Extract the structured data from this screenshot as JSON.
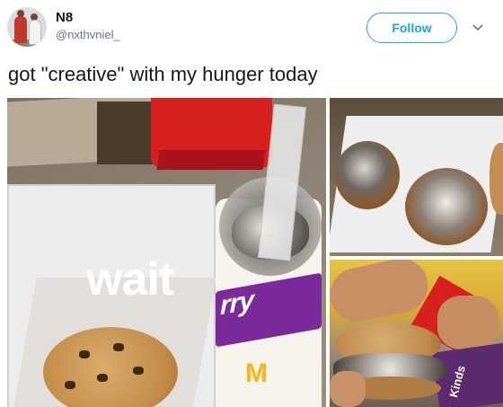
{
  "header": {
    "display_name": "N8",
    "handle": "@nxthvniel_",
    "follow_label": "Follow",
    "menu_icon": "chevron-down-icon"
  },
  "tweet": {
    "text": "got \"creative\" with my hunger today"
  },
  "media": {
    "overlay_text": "wait",
    "cup_text": "rry",
    "cup_logo": "M",
    "box_text": "Kinds"
  },
  "colors": {
    "follow_blue": "#1da1f2",
    "text": "#14171a",
    "muted": "#657786",
    "mcdonalds_red": "#d8201e",
    "mcflurry_purple": "#7a2a9a"
  }
}
